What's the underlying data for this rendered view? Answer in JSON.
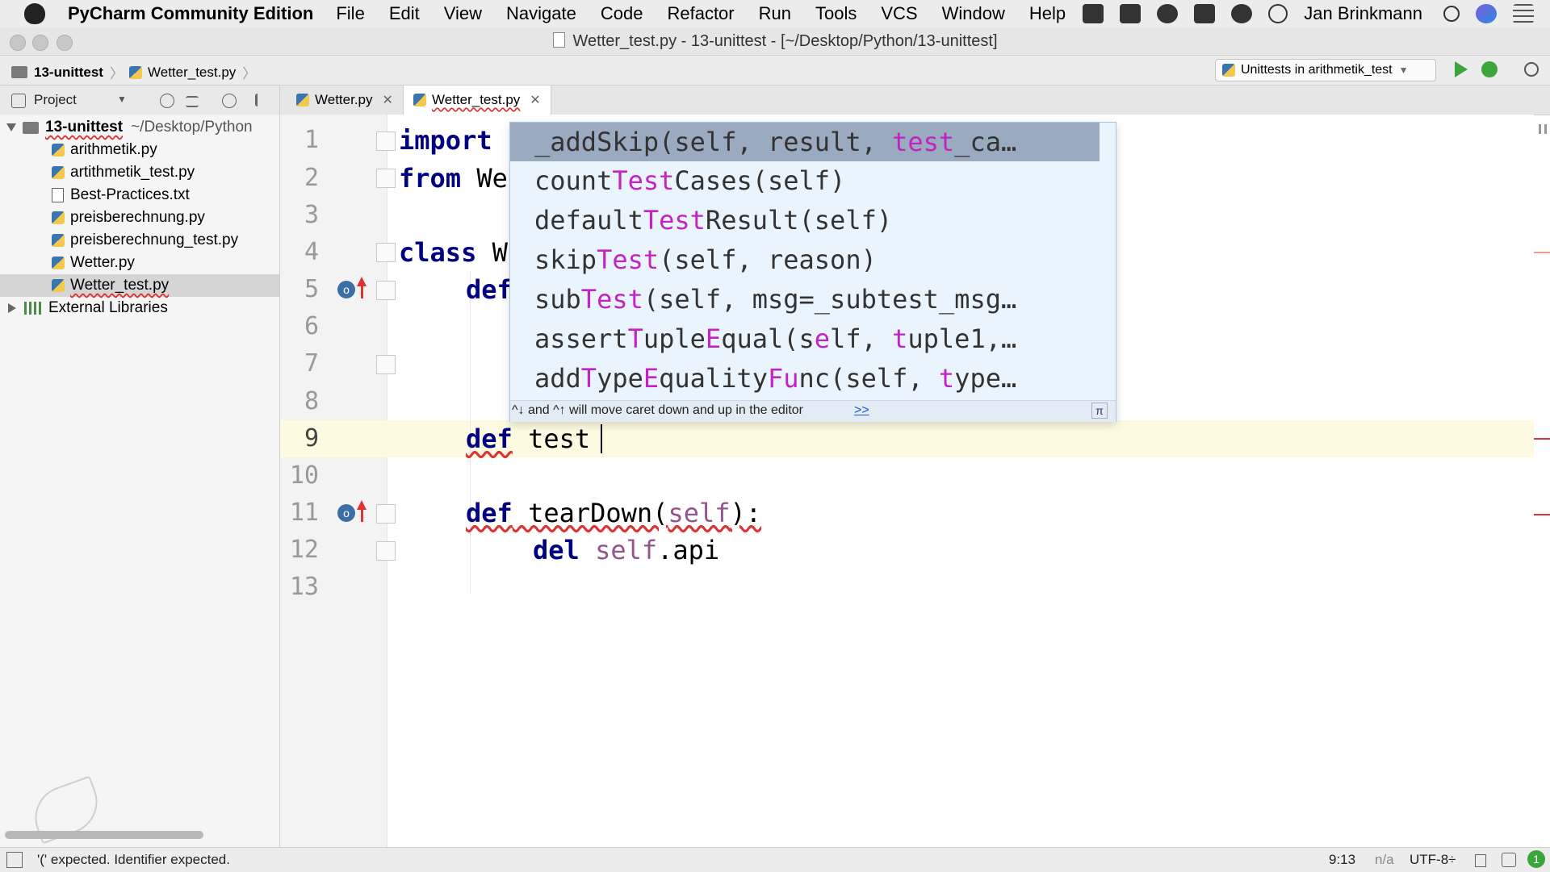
{
  "menubar": {
    "app_name": "PyCharm Community Edition",
    "items": [
      "File",
      "Edit",
      "View",
      "Navigate",
      "Code",
      "Refactor",
      "Run",
      "Tools",
      "VCS",
      "Window",
      "Help"
    ],
    "user": "Jan Brinkmann"
  },
  "window": {
    "title": "Wetter_test.py - 13-unittest - [~/Desktop/Python/13-unittest]"
  },
  "navbar": {
    "crumbs": [
      "13-unittest",
      "Wetter_test.py"
    ],
    "run_config": "Unittests in arithmetik_test"
  },
  "project_panel": {
    "header": "Project",
    "root": "13-unittest",
    "root_path": "~/Desktop/Python",
    "files": [
      "arithmetik.py",
      "artithmetik_test.py",
      "Best-Practices.txt",
      "preisberechnung.py",
      "preisberechnung_test.py",
      "Wetter.py",
      "Wetter_test.py"
    ],
    "selected_file": "Wetter_test.py",
    "external": "External Libraries"
  },
  "tabs": [
    {
      "label": "Wetter.py",
      "active": false
    },
    {
      "label": "Wetter_test.py",
      "active": true
    }
  ],
  "editor": {
    "line_numbers": [
      "1",
      "2",
      "3",
      "4",
      "5",
      "6",
      "7",
      "8",
      "9",
      "10",
      "11",
      "12",
      "13"
    ],
    "lines": {
      "l1": {
        "kw": "import",
        "rest": ""
      },
      "l2": {
        "kw": "from",
        "rest": " We"
      },
      "l4": {
        "kw": "class",
        "rest": " W"
      },
      "l5": {
        "kw": "def",
        "rest": ""
      },
      "l9": {
        "kw": "def",
        "rest": " test"
      },
      "l11": {
        "kw": "def",
        "name": " tearDown(",
        "self": "self",
        "tail": "):"
      },
      "l12": {
        "kw": "del",
        "self": " self",
        "tail": ".api"
      }
    },
    "override_marker": "o"
  },
  "autocomplete": {
    "items": [
      {
        "pre": "_addSkip(self, result, ",
        "hl": "test",
        "post": "_ca…"
      },
      {
        "pre": "count",
        "hl": "Test",
        "post": "Cases(self)"
      },
      {
        "pre": "default",
        "hl": "Test",
        "post": "Result(self)"
      },
      {
        "pre": "skip",
        "hl": "Test",
        "post": "(self, reason)"
      },
      {
        "pre": "sub",
        "hl": "Test",
        "post": "(self, msg=_subtest_msg…"
      },
      {
        "pre": "assert",
        "hl": "T",
        "mid": "uple",
        "hl2": "E",
        "mid2": "qual(s",
        "hl3": "e",
        "mid3": "lf, ",
        "hl4": "t",
        "post": "uple1,…"
      },
      {
        "pre": "add",
        "hl": "T",
        "mid": "ype",
        "hl2": "E",
        "mid2": "quality",
        "hl3": "Fu",
        "mid3": "nc(self, ",
        "hl4": "t",
        "post": "ype…"
      }
    ],
    "footer_hint": "^↓ and ^↑ will move caret down and up in the editor",
    "footer_more": ">>",
    "pi_symbol": "π"
  },
  "status": {
    "message": "'(' expected. Identifier expected.",
    "position": "9:13",
    "na": "n/a",
    "encoding": "UTF-8÷",
    "badge": "1"
  }
}
